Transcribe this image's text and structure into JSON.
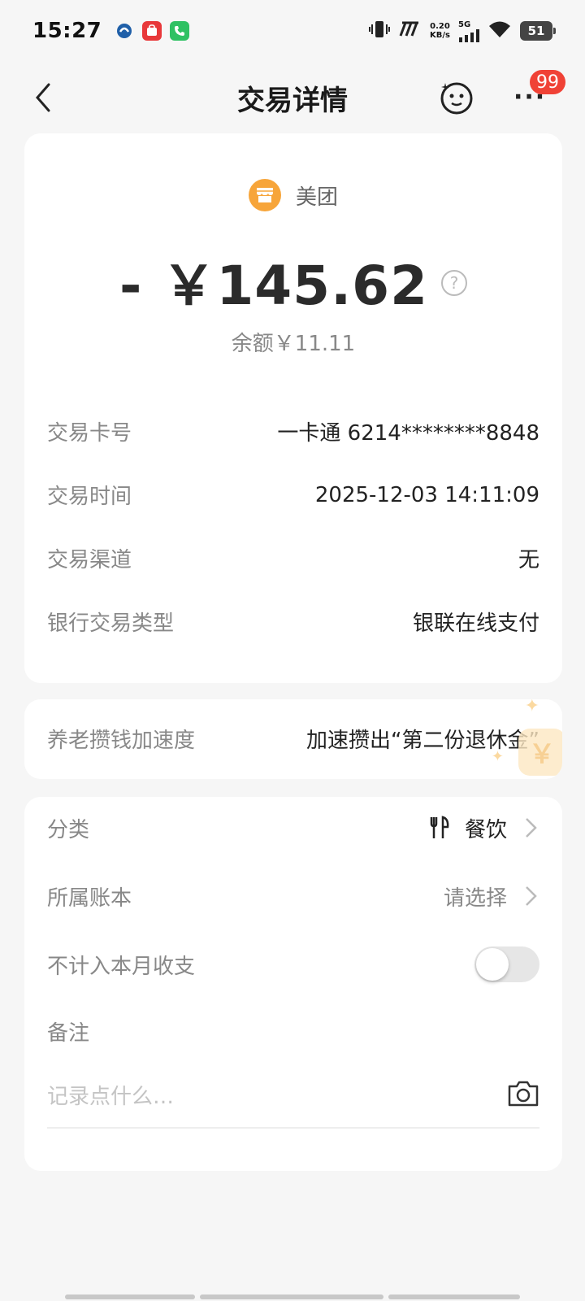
{
  "status_bar": {
    "time": "15:27",
    "net_speed_value": "0.20",
    "net_speed_unit": "KB/s",
    "network": "5G",
    "battery": "51"
  },
  "nav": {
    "title": "交易详情",
    "badge": "99",
    "more": "···"
  },
  "summary": {
    "merchant": "美团",
    "amount": "- ￥145.62",
    "help": "?",
    "balance": "余额￥11.11"
  },
  "details": [
    {
      "label": "交易卡号",
      "value": "一卡通 6214********8848"
    },
    {
      "label": "交易时间",
      "value": "2025-12-03 14:11:09"
    },
    {
      "label": "交易渠道",
      "value": "无"
    },
    {
      "label": "银行交易类型",
      "value": "银联在线支付"
    }
  ],
  "promo": {
    "label": "养老攒钱加速度",
    "value": "加速攒出“第二份退休金”",
    "coin": "￥"
  },
  "settings": {
    "category_label": "分类",
    "category_value": "餐饮",
    "ledger_label": "所属账本",
    "ledger_value": "请选择",
    "exclude_label": "不计入本月收支",
    "exclude_on": false,
    "note_label": "备注",
    "note_placeholder": "记录点什么…"
  },
  "colors": {
    "accent_orange": "#f7a53a",
    "badge_red": "#f04236"
  }
}
